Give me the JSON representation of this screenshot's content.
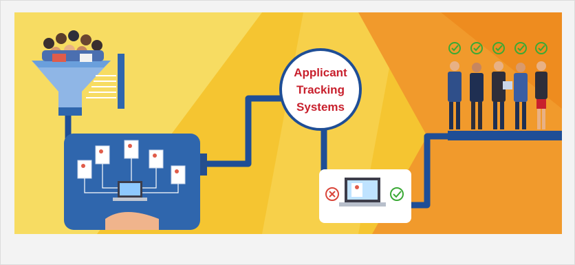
{
  "banner": {
    "title_line1": "Applicant",
    "title_line2": "Tracking",
    "title_line3": "Systems"
  },
  "colors": {
    "yellow_light": "#f7d955",
    "yellow": "#f4c025",
    "orange": "#f0942a",
    "orange_dark": "#ee8a1f",
    "pipe_blue": "#1f4e96",
    "machine_blue": "#2f66ad",
    "title_red": "#c8202d",
    "check_green": "#3aa935",
    "reject_red": "#d9453a"
  },
  "icons": {
    "funnel": "funnel-icon",
    "resume": "resume-icon",
    "laptop": "laptop-icon",
    "check": "check-circle-icon",
    "reject": "x-circle-icon",
    "person": "person-icon"
  }
}
